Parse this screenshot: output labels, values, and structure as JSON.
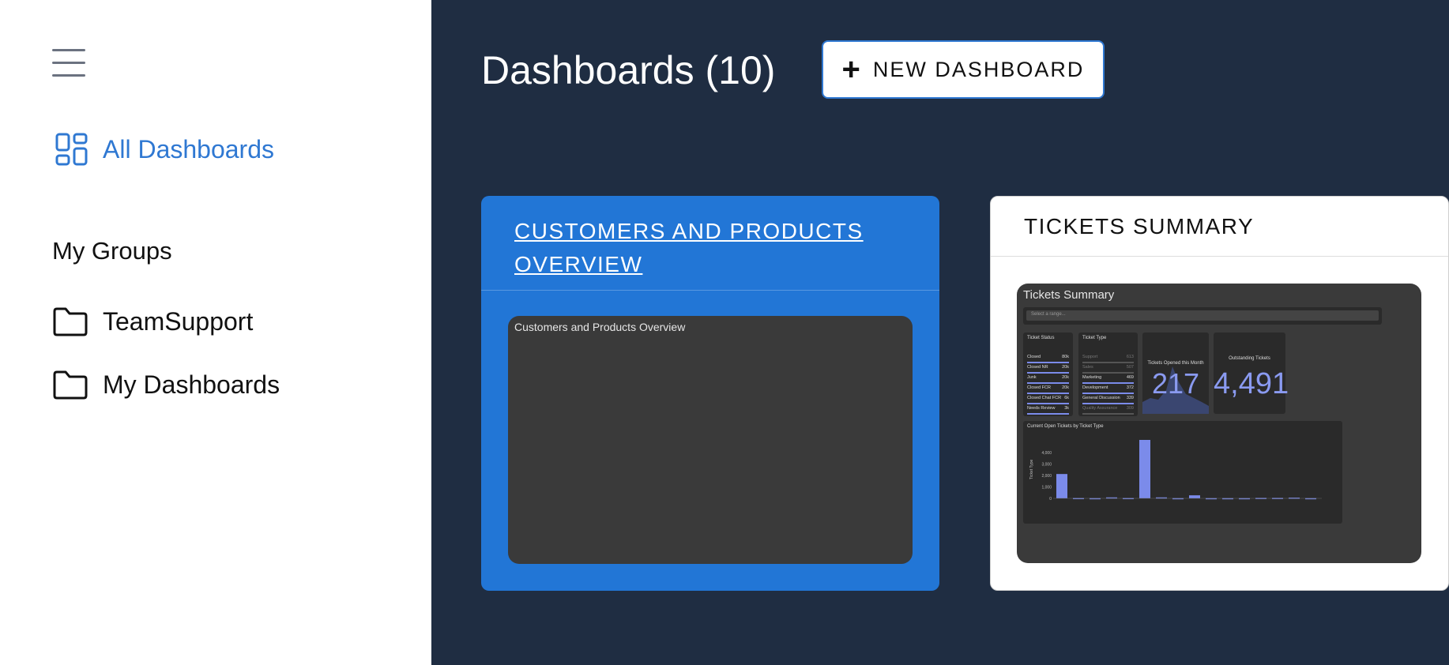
{
  "sidebar": {
    "nav_all": "All Dashboards",
    "groups_title": "My Groups",
    "groups": [
      "TeamSupport",
      "My Dashboards"
    ]
  },
  "colors": {
    "accent": "#2f78d2",
    "background": "#1f2d42",
    "card_active": "#2276d6",
    "thumb_bg": "#3a3a3a",
    "bar_color": "#7b8bea"
  },
  "main": {
    "title": "Dashboards (10)",
    "new_button": "NEW DASHBOARD"
  },
  "cards": [
    {
      "title": "CUSTOMERS AND PRODUCTS OVERVIEW",
      "thumb_title": "Customers and Products Overview"
    },
    {
      "title": "TICKETS SUMMARY",
      "thumb_title": "Tickets Summary",
      "range_placeholder": "Select a range...",
      "status_title": "Ticket Status",
      "status_rows": [
        {
          "label": "Closed",
          "value": "80k"
        },
        {
          "label": "Closed NR",
          "value": "20k"
        },
        {
          "label": "Junk",
          "value": "20k"
        },
        {
          "label": "Closed FCR",
          "value": "20k"
        },
        {
          "label": "Closed Chat FCR",
          "value": "6k"
        },
        {
          "label": "Needs Review",
          "value": "3k"
        }
      ],
      "type_title": "Ticket Type",
      "type_rows": [
        {
          "label": "Support",
          "value": "613"
        },
        {
          "label": "Sales",
          "value": "507"
        },
        {
          "label": "Marketing",
          "value": "469"
        },
        {
          "label": "Development",
          "value": "372"
        },
        {
          "label": "General Discussion",
          "value": "339"
        },
        {
          "label": "Quality Assurance",
          "value": "309"
        }
      ],
      "opened_title": "Tickets Opened this Month",
      "opened_value": "217",
      "outstanding_title": "Outstanding Tickets",
      "outstanding_value": "4,491",
      "bar_chart_title": "Current Open Tickets by Ticket Type",
      "bar_chart_ylabel": "Ticket Type",
      "bar_chart_yticks": [
        "4,000",
        "3,000",
        "2,000",
        "1,000",
        "0"
      ],
      "bar_values": [
        2000,
        30,
        20,
        80,
        30,
        4800,
        80,
        20,
        250,
        20,
        20,
        20,
        40,
        40,
        60,
        20
      ]
    }
  ]
}
